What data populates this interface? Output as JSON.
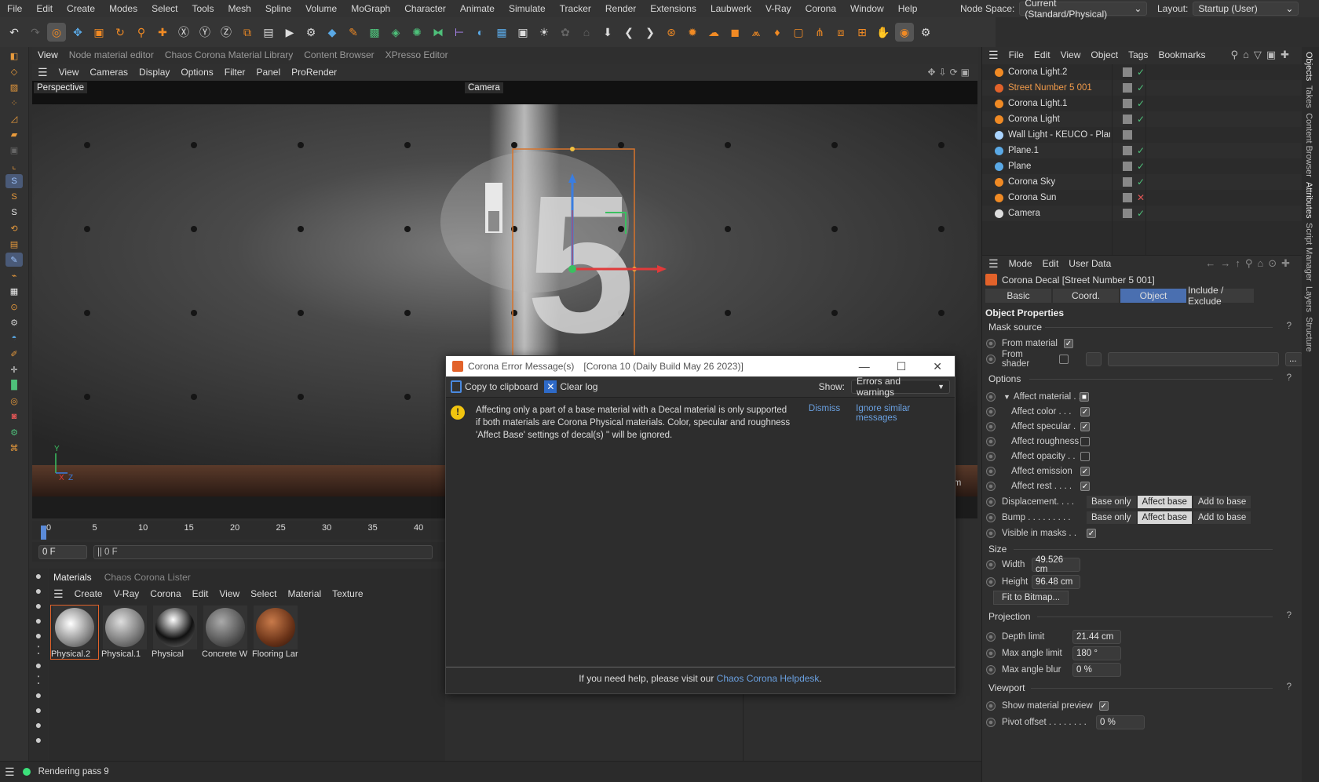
{
  "menubar": {
    "items": [
      "File",
      "Edit",
      "Create",
      "Modes",
      "Select",
      "Tools",
      "Mesh",
      "Spline",
      "Volume",
      "MoGraph",
      "Character",
      "Animate",
      "Simulate",
      "Tracker",
      "Render",
      "Extensions",
      "Laubwerk",
      "V-Ray",
      "Corona",
      "Window",
      "Help"
    ],
    "node_space_label": "Node Space:",
    "node_space_value": "Current (Standard/Physical)",
    "layout_label": "Layout:",
    "layout_value": "Startup (User)"
  },
  "editor_tabs": [
    "View",
    "Node material editor",
    "Chaos Corona Material Library",
    "Content Browser",
    "XPresso Editor"
  ],
  "viewport": {
    "menu": [
      "View",
      "Cameras",
      "Display",
      "Options",
      "Filter",
      "Panel",
      "ProRender"
    ],
    "name": "Perspective",
    "camera": "Camera",
    "unit": "cm"
  },
  "timeline": {
    "ticks": [
      "0",
      "5",
      "10",
      "15",
      "20",
      "25",
      "30",
      "35",
      "40"
    ],
    "frame_field": "0 F",
    "frame_field2": "0 F"
  },
  "materials": {
    "tabs": [
      "Materials",
      "Chaos Corona Lister"
    ],
    "menu": [
      "Create",
      "V-Ray",
      "Corona",
      "Edit",
      "View",
      "Select",
      "Material",
      "Texture"
    ],
    "items": [
      {
        "name": "Physical.2"
      },
      {
        "name": "Physical.1"
      },
      {
        "name": "Physical"
      },
      {
        "name": "Concrete W"
      },
      {
        "name": "Flooring Lar"
      }
    ]
  },
  "status": {
    "text": "Rendering pass 9"
  },
  "objects": {
    "menu": [
      "File",
      "Edit",
      "View",
      "Object",
      "Tags",
      "Bookmarks"
    ],
    "items": [
      {
        "name": "Corona Light.2",
        "highlight": false
      },
      {
        "name": "Street Number 5 001",
        "highlight": true
      },
      {
        "name": "Corona Light.1",
        "highlight": false
      },
      {
        "name": "Corona Light",
        "highlight": false
      },
      {
        "name": "Wall Light - KEUCO - Plan",
        "highlight": false
      },
      {
        "name": "Plane.1",
        "highlight": false
      },
      {
        "name": "Plane",
        "highlight": false
      },
      {
        "name": "Corona Sky",
        "highlight": false
      },
      {
        "name": "Corona Sun",
        "highlight": false
      },
      {
        "name": "Camera",
        "highlight": false
      }
    ]
  },
  "side_tabs": [
    "Objects",
    "Takes",
    "Content Browser",
    "Attributes",
    "Script Manager",
    "Layers",
    "Structure"
  ],
  "attributes": {
    "menu": [
      "Mode",
      "Edit",
      "User Data"
    ],
    "title": "Corona Decal [Street Number 5 001]",
    "tabs": [
      "Basic",
      "Coord.",
      "Object",
      "Include / Exclude"
    ],
    "active_tab": "Object",
    "section_title": "Object Properties",
    "mask_source": {
      "header": "Mask source",
      "from_material": "From material",
      "from_shader": "From shader"
    },
    "options": {
      "header": "Options",
      "affect_material": "Affect material . .",
      "affect_color": "Affect color . . .",
      "affect_specular": "Affect specular .",
      "affect_roughness": "Affect roughness",
      "affect_opacity": "Affect opacity . .",
      "affect_emission": "Affect emission",
      "affect_rest": "Affect rest . . . .",
      "displacement": "Displacement. . . .",
      "bump": "Bump . . . . . . . . .",
      "visible_in_masks": "Visible in masks . .",
      "mode_buttons": [
        "Base only",
        "Affect base",
        "Add to base"
      ]
    },
    "size": {
      "header": "Size",
      "width_label": "Width",
      "width": "49.526 cm",
      "height_label": "Height",
      "height": "96.48 cm",
      "fit": "Fit to Bitmap..."
    },
    "projection": {
      "header": "Projection",
      "depth_label": "Depth limit",
      "depth": "21.44 cm",
      "max_angle_label": "Max angle limit",
      "max_angle": "180 °",
      "blur_label": "Max angle blur",
      "blur": "0 %"
    },
    "viewport": {
      "header": "Viewport",
      "preview": "Show material preview",
      "pivot_label": "Pivot offset . . . . . . . .",
      "pivot": "0 %"
    }
  },
  "dialog": {
    "title": "Corona Error Message(s)",
    "subtitle": "[Corona 10 (Daily Build May 26 2023)]",
    "copy": "Copy to clipboard",
    "clear": "Clear log",
    "show_label": "Show:",
    "show_value": "Errors and warnings",
    "message": "Affecting only a part of a base material with a Decal material is only supported if both materials are Corona Physical materials. Color, specular and roughness 'Affect Base' settings of decal(s) '' will be ignored.",
    "dismiss": "Dismiss",
    "ignore": "Ignore similar messages",
    "help_prefix": "If you need help, please visit our",
    "help_link": "Chaos Corona Helpdesk",
    "help_suffix": "."
  }
}
